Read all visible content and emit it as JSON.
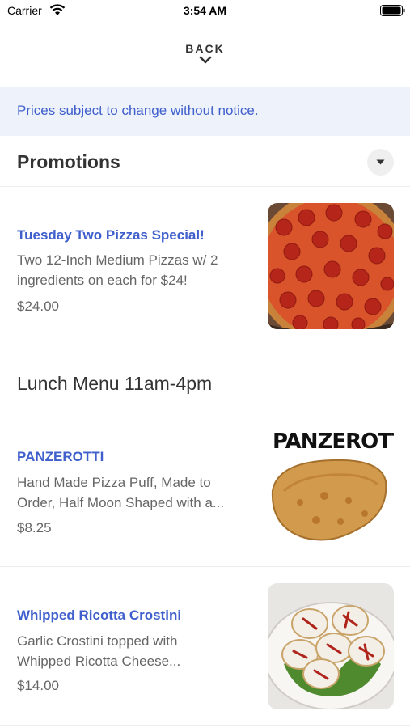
{
  "status_bar": {
    "carrier": "Carrier",
    "time": "3:54 AM"
  },
  "nav": {
    "back_label": "BACK"
  },
  "notice": {
    "text": "Prices subject to change without notice."
  },
  "sections": [
    {
      "title": "Promotions",
      "items": [
        {
          "name": "Tuesday Two Pizzas Special!",
          "desc_line1": "Two 12-Inch Medium Pizzas w/ 2",
          "desc_line2": "ingredients on each for $24!",
          "price": "$24.00",
          "image": "pepperoni-pizza"
        }
      ]
    },
    {
      "title": "Lunch Menu 11am-4pm",
      "items": [
        {
          "name": "PANZEROTTI",
          "desc_line1": "Hand Made Pizza Puff, Made to",
          "desc_line2": "Order, Half Moon Shaped with a...",
          "price": "$8.25",
          "image": "panzerotti",
          "image_caption": "PANZEROTTI"
        },
        {
          "name": "Whipped Ricotta Crostini",
          "desc_line1": "Garlic Crostini topped with",
          "desc_line2": "Whipped Ricotta Cheese...",
          "price": "$14.00",
          "image": "ricotta-crostini"
        }
      ]
    }
  ],
  "colors": {
    "accent": "#3f5fcc",
    "notice_bg": "#eef2fb"
  }
}
